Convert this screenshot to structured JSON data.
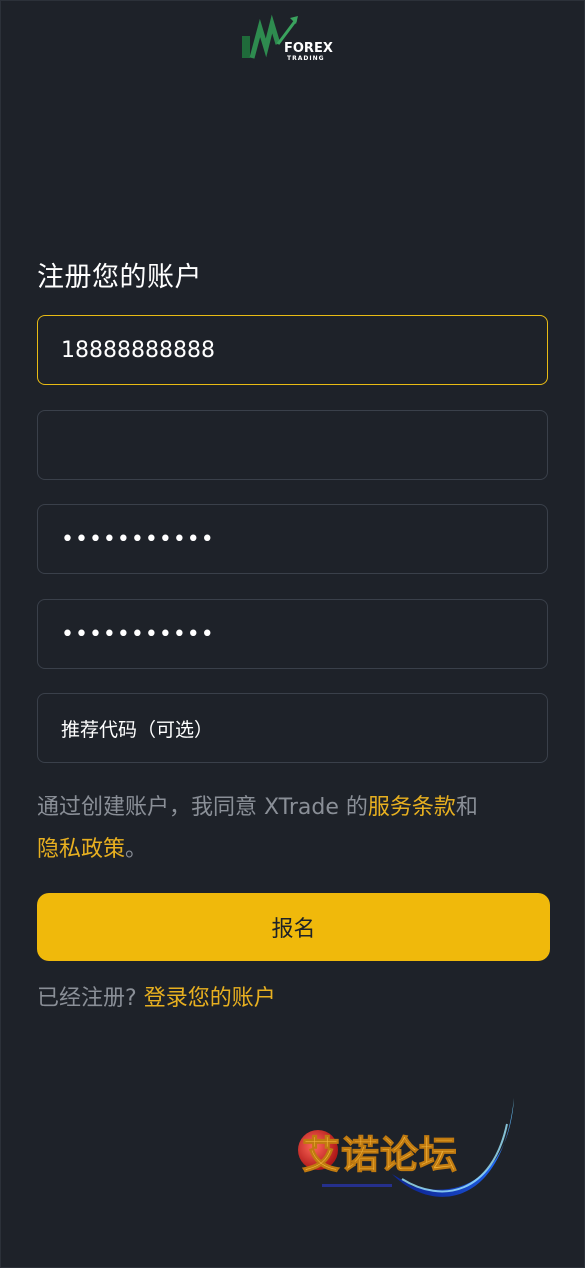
{
  "logo": {
    "text_top": "FOREX",
    "text_bottom": "TRADING"
  },
  "form": {
    "title": "注册您的账户",
    "phone_value": "18888888888",
    "field2_value": "",
    "password_mask": "•••••••••••",
    "confirm_password_mask": "•••••••••••",
    "referral_placeholder": "推荐代码（可选）"
  },
  "terms": {
    "prefix": "通过创建账户，我同意 XTrade 的",
    "terms_link": "服务条款",
    "and": "和",
    "privacy_link": "隐私政策",
    "suffix": "。"
  },
  "signup_button_label": "报名",
  "login": {
    "prompt": "已经注册?",
    "link": "登录您的账户"
  },
  "watermark": {
    "text": "艾诺论坛"
  },
  "colors": {
    "background": "#1e2229",
    "accent": "#f0b90b",
    "link": "#e8b020",
    "muted_text": "#8a8f97",
    "border": "#3a404a",
    "active_border": "#e8bb14"
  }
}
